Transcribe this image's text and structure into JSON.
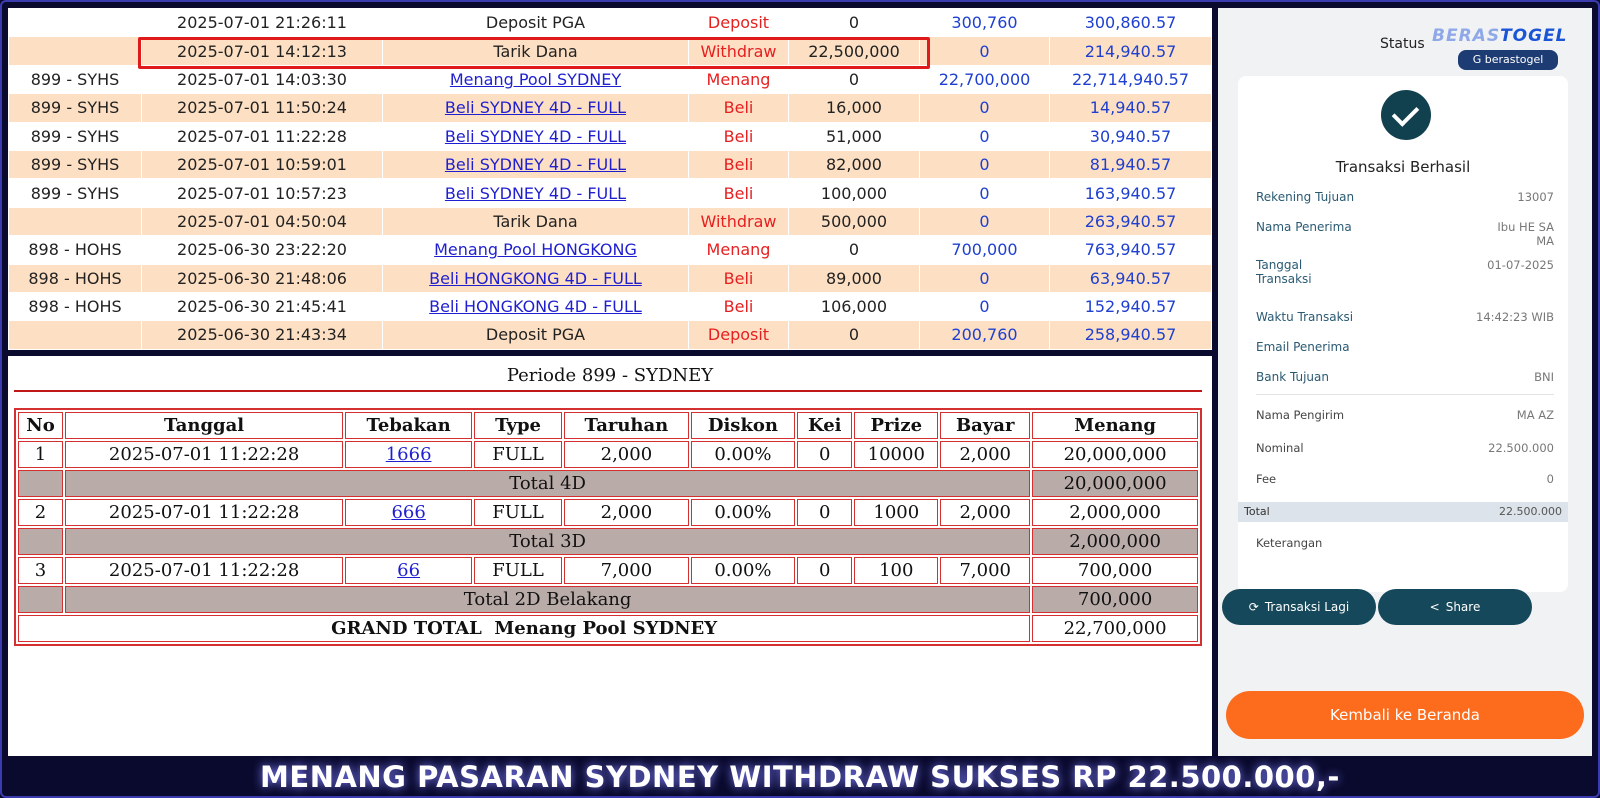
{
  "transactions": [
    {
      "code": "",
      "date": "2025-07-01 21:26:11",
      "desc": "Deposit PGA",
      "link": false,
      "type": "Deposit",
      "debit": "0",
      "credit": "300,760",
      "balance": "300,860.57"
    },
    {
      "code": "",
      "date": "2025-07-01 14:12:13",
      "desc": "Tarik Dana",
      "link": false,
      "type": "Withdraw",
      "debit": "22,500,000",
      "credit": "0",
      "balance": "214,940.57"
    },
    {
      "code": "899 - SYHS",
      "date": "2025-07-01 14:03:30",
      "desc": "Menang Pool SYDNEY",
      "link": true,
      "type": "Menang",
      "debit": "0",
      "credit": "22,700,000",
      "balance": "22,714,940.57"
    },
    {
      "code": "899 - SYHS",
      "date": "2025-07-01 11:50:24",
      "desc": "Beli SYDNEY 4D - FULL",
      "link": true,
      "type": "Beli",
      "debit": "16,000",
      "credit": "0",
      "balance": "14,940.57"
    },
    {
      "code": "899 - SYHS",
      "date": "2025-07-01 11:22:28",
      "desc": "Beli SYDNEY 4D - FULL",
      "link": true,
      "type": "Beli",
      "debit": "51,000",
      "credit": "0",
      "balance": "30,940.57"
    },
    {
      "code": "899 - SYHS",
      "date": "2025-07-01 10:59:01",
      "desc": "Beli SYDNEY 4D - FULL",
      "link": true,
      "type": "Beli",
      "debit": "82,000",
      "credit": "0",
      "balance": "81,940.57"
    },
    {
      "code": "899 - SYHS",
      "date": "2025-07-01 10:57:23",
      "desc": "Beli SYDNEY 4D - FULL",
      "link": true,
      "type": "Beli",
      "debit": "100,000",
      "credit": "0",
      "balance": "163,940.57"
    },
    {
      "code": "",
      "date": "2025-07-01 04:50:04",
      "desc": "Tarik Dana",
      "link": false,
      "type": "Withdraw",
      "debit": "500,000",
      "credit": "0",
      "balance": "263,940.57"
    },
    {
      "code": "898 - HOHS",
      "date": "2025-06-30 23:22:20",
      "desc": "Menang Pool HONGKONG",
      "link": true,
      "type": "Menang",
      "debit": "0",
      "credit": "700,000",
      "balance": "763,940.57"
    },
    {
      "code": "898 - HOHS",
      "date": "2025-06-30 21:48:06",
      "desc": "Beli HONGKONG 4D - FULL",
      "link": true,
      "type": "Beli",
      "debit": "89,000",
      "credit": "0",
      "balance": "63,940.57"
    },
    {
      "code": "898 - HOHS",
      "date": "2025-06-30 21:45:41",
      "desc": "Beli HONGKONG 4D - FULL",
      "link": true,
      "type": "Beli",
      "debit": "106,000",
      "credit": "0",
      "balance": "152,940.57"
    },
    {
      "code": "",
      "date": "2025-06-30 21:43:34",
      "desc": "Deposit PGA",
      "link": false,
      "type": "Deposit",
      "debit": "0",
      "credit": "200,760",
      "balance": "258,940.57"
    }
  ],
  "detail": {
    "title": "Periode 899 - SYDNEY",
    "headers": [
      "No",
      "Tanggal",
      "Tebakan",
      "Type",
      "Taruhan",
      "Diskon",
      "Kei",
      "Prize",
      "Bayar",
      "Menang"
    ],
    "groups": [
      {
        "row": [
          "1",
          "2025-07-01 11:22:28",
          "1666",
          "FULL",
          "2,000",
          "0.00%",
          "0",
          "10000",
          "2,000",
          "20,000,000"
        ],
        "total_label": "Total 4D",
        "total_value": "20,000,000"
      },
      {
        "row": [
          "2",
          "2025-07-01 11:22:28",
          "666",
          "FULL",
          "2,000",
          "0.00%",
          "0",
          "1000",
          "2,000",
          "2,000,000"
        ],
        "total_label": "Total 3D",
        "total_value": "2,000,000"
      },
      {
        "row": [
          "3",
          "2025-07-01 11:22:28",
          "66",
          "FULL",
          "7,000",
          "0.00%",
          "0",
          "100",
          "7,000",
          "700,000"
        ],
        "total_label": "Total 2D Belakang",
        "total_value": "700,000"
      }
    ],
    "grand_label": "GRAND TOTAL  Menang Pool SYDNEY",
    "grand_value": "22,700,000"
  },
  "receipt": {
    "status_label": "Status",
    "logo_text_a": "BERAS",
    "logo_text_b": "TOGEL",
    "badge": "G berastogel",
    "success": "Transaksi Berhasil",
    "rek_label": "Rekening Tujuan",
    "rek_value": "13007",
    "nama_label": "Nama Penerima",
    "nama_value": "Ibu HE SA",
    "nama_value2": "MA",
    "tgl_label": "Tanggal",
    "tgl_label2": "Transaksi",
    "tgl_value": "01-07-2025",
    "waktu_label": "Waktu Transaksi",
    "waktu_value": "14:42:23 WIB",
    "email_label": "Email Penerima",
    "bank_label": "Bank Tujuan",
    "bank_value": "BNI",
    "pengirim_label": "Nama Pengirim",
    "pengirim_value": "MA AZ",
    "nominal_label": "Nominal",
    "nominal_value": "22.500.000",
    "fee_label": "Fee",
    "fee_value": "0",
    "total_label": "Total",
    "total_value": "22.500.000",
    "ket_label": "Keterangan",
    "btn_again": "Transaksi Lagi",
    "btn_share": "Share",
    "btn_home": "Kembali ke Beranda",
    "icons": [
      "check-icon",
      "refresh-icon",
      "share-icon"
    ]
  },
  "banner": "MENANG PASARAN SYDNEY WITHDRAW SUKSES RP 22.500.000,-",
  "colors": {
    "row_alt": "#fde0c4",
    "withdraw_red": "#e62020",
    "credit_blue": "#1e3fcf",
    "accent_orange": "#fd6b1c",
    "dark_teal": "#15485a"
  }
}
